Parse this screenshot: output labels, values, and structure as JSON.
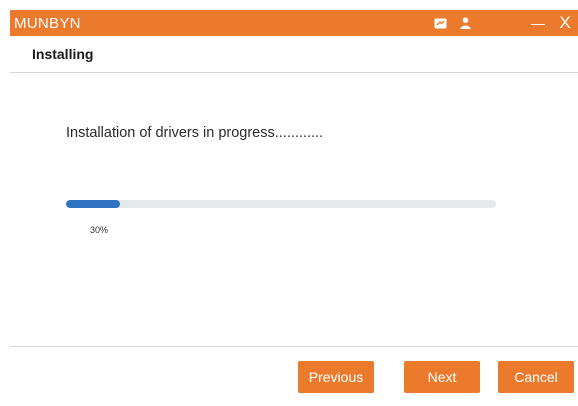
{
  "window": {
    "app_title": "MUNBYN",
    "minimize_symbol": "—",
    "close_symbol": "X",
    "accent_color": "#ec7a2d",
    "icons": [
      "feedback-icon",
      "user-icon"
    ]
  },
  "header": {
    "title": "Installing"
  },
  "main": {
    "status_text": "Installation of drivers in progress............",
    "progress": {
      "value": 0.3,
      "label": "30%",
      "fill_color": "#2f74c0",
      "track_color": "#e6e8ec"
    }
  },
  "footer": {
    "previous_label": "Previous",
    "next_label": "Next",
    "cancel_label": "Cancel"
  }
}
